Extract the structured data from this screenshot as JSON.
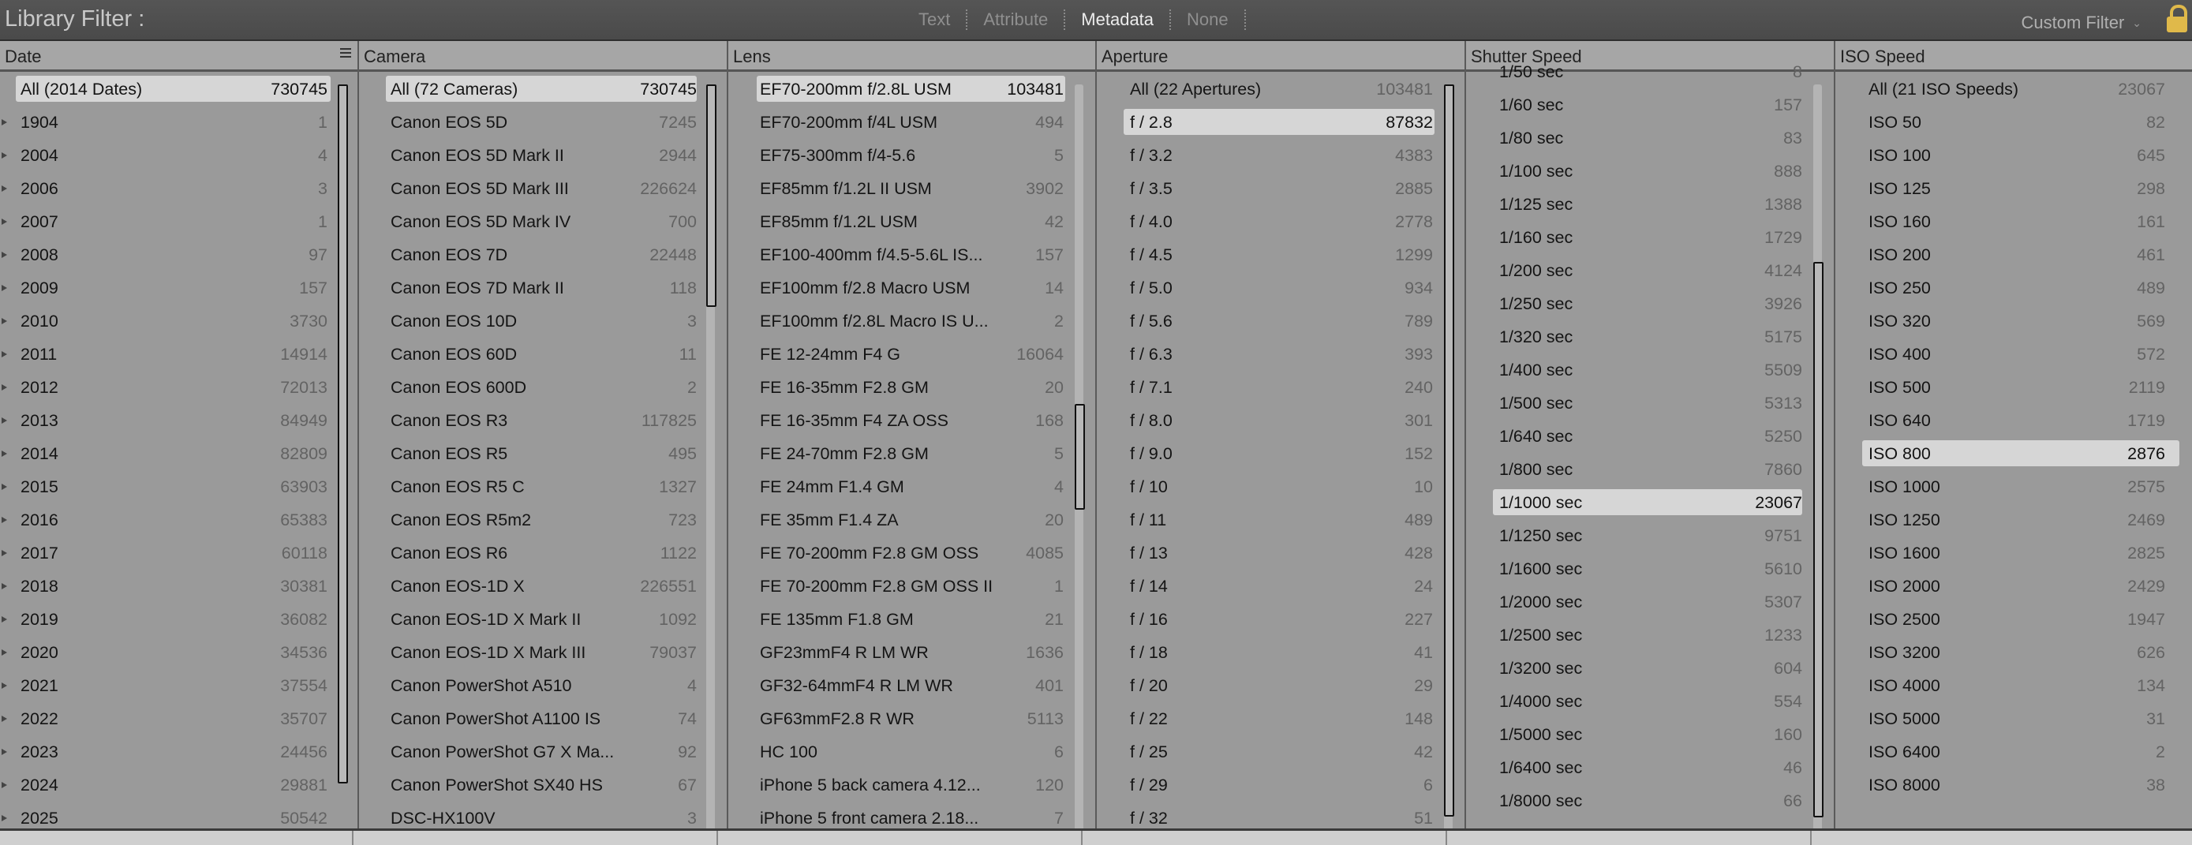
{
  "topbar": {
    "title": "Library Filter :",
    "tabs": [
      "Text",
      "Attribute",
      "Metadata",
      "None"
    ],
    "active_tab": "Metadata",
    "preset": "Custom Filter",
    "lock_color": "#e0b94a"
  },
  "columns": [
    {
      "header": "Date",
      "rows": [
        {
          "label": "All (2014 Dates)",
          "count": "730745",
          "selected": true
        },
        {
          "label": "1904",
          "count": "1",
          "expandable": true
        },
        {
          "label": "2004",
          "count": "4",
          "expandable": true
        },
        {
          "label": "2006",
          "count": "3",
          "expandable": true
        },
        {
          "label": "2007",
          "count": "1",
          "expandable": true
        },
        {
          "label": "2008",
          "count": "97",
          "expandable": true
        },
        {
          "label": "2009",
          "count": "157",
          "expandable": true
        },
        {
          "label": "2010",
          "count": "3730",
          "expandable": true
        },
        {
          "label": "2011",
          "count": "14914",
          "expandable": true
        },
        {
          "label": "2012",
          "count": "72013",
          "expandable": true
        },
        {
          "label": "2013",
          "count": "84949",
          "expandable": true
        },
        {
          "label": "2014",
          "count": "82809",
          "expandable": true
        },
        {
          "label": "2015",
          "count": "63903",
          "expandable": true
        },
        {
          "label": "2016",
          "count": "65383",
          "expandable": true
        },
        {
          "label": "2017",
          "count": "60118",
          "expandable": true
        },
        {
          "label": "2018",
          "count": "30381",
          "expandable": true
        },
        {
          "label": "2019",
          "count": "36082",
          "expandable": true
        },
        {
          "label": "2020",
          "count": "34536",
          "expandable": true
        },
        {
          "label": "2021",
          "count": "37554",
          "expandable": true
        },
        {
          "label": "2022",
          "count": "35707",
          "expandable": true
        },
        {
          "label": "2023",
          "count": "24456",
          "expandable": true
        },
        {
          "label": "2024",
          "count": "29881",
          "expandable": true
        },
        {
          "label": "2025",
          "count": "50542",
          "expandable": true
        }
      ]
    },
    {
      "header": "Camera",
      "rows": [
        {
          "label": "All (72 Cameras)",
          "count": "730745",
          "selected": true
        },
        {
          "label": "Canon EOS 5D",
          "count": "7245"
        },
        {
          "label": "Canon EOS 5D Mark II",
          "count": "2944"
        },
        {
          "label": "Canon EOS 5D Mark III",
          "count": "226624"
        },
        {
          "label": "Canon EOS 5D Mark IV",
          "count": "700"
        },
        {
          "label": "Canon EOS 7D",
          "count": "22448"
        },
        {
          "label": "Canon EOS 7D Mark II",
          "count": "118"
        },
        {
          "label": "Canon EOS 10D",
          "count": "3"
        },
        {
          "label": "Canon EOS 60D",
          "count": "11"
        },
        {
          "label": "Canon EOS 600D",
          "count": "2"
        },
        {
          "label": "Canon EOS R3",
          "count": "117825"
        },
        {
          "label": "Canon EOS R5",
          "count": "495"
        },
        {
          "label": "Canon EOS R5 C",
          "count": "1327"
        },
        {
          "label": "Canon EOS R5m2",
          "count": "723"
        },
        {
          "label": "Canon EOS R6",
          "count": "1122"
        },
        {
          "label": "Canon EOS-1D X",
          "count": "226551"
        },
        {
          "label": "Canon EOS-1D X Mark II",
          "count": "1092"
        },
        {
          "label": "Canon EOS-1D X Mark III",
          "count": "79037"
        },
        {
          "label": "Canon PowerShot A510",
          "count": "4"
        },
        {
          "label": "Canon PowerShot A1100 IS",
          "count": "74"
        },
        {
          "label": "Canon PowerShot G7 X Ma...",
          "count": "92"
        },
        {
          "label": "Canon PowerShot SX40 HS",
          "count": "67"
        },
        {
          "label": "DSC-HX100V",
          "count": "3"
        }
      ]
    },
    {
      "header": "Lens",
      "rows": [
        {
          "label": "EF70-200mm f/2.8L USM",
          "count": "103481",
          "selected": true
        },
        {
          "label": "EF70-200mm f/4L USM",
          "count": "494"
        },
        {
          "label": "EF75-300mm f/4-5.6",
          "count": "5"
        },
        {
          "label": "EF85mm f/1.2L II USM",
          "count": "3902"
        },
        {
          "label": "EF85mm f/1.2L USM",
          "count": "42"
        },
        {
          "label": "EF100-400mm f/4.5-5.6L IS...",
          "count": "157"
        },
        {
          "label": "EF100mm f/2.8 Macro USM",
          "count": "14"
        },
        {
          "label": "EF100mm f/2.8L Macro IS U...",
          "count": "2"
        },
        {
          "label": "FE 12-24mm F4 G",
          "count": "16064"
        },
        {
          "label": "FE 16-35mm F2.8 GM",
          "count": "20"
        },
        {
          "label": "FE 16-35mm F4 ZA OSS",
          "count": "168"
        },
        {
          "label": "FE 24-70mm F2.8 GM",
          "count": "5"
        },
        {
          "label": "FE 24mm F1.4 GM",
          "count": "4"
        },
        {
          "label": "FE 35mm F1.4 ZA",
          "count": "20"
        },
        {
          "label": "FE 70-200mm F2.8 GM OSS",
          "count": "4085"
        },
        {
          "label": "FE 70-200mm F2.8 GM OSS II",
          "count": "1"
        },
        {
          "label": "FE 135mm F1.8 GM",
          "count": "21"
        },
        {
          "label": "GF23mmF4 R LM WR",
          "count": "1636"
        },
        {
          "label": "GF32-64mmF4 R LM WR",
          "count": "401"
        },
        {
          "label": "GF63mmF2.8 R WR",
          "count": "5113"
        },
        {
          "label": "HC 100",
          "count": "6"
        },
        {
          "label": "iPhone 5 back camera 4.12...",
          "count": "120"
        },
        {
          "label": "iPhone 5 front camera 2.18...",
          "count": "7"
        }
      ]
    },
    {
      "header": "Aperture",
      "rows": [
        {
          "label": "All (22 Apertures)",
          "count": "103481"
        },
        {
          "label": "f / 2.8",
          "count": "87832",
          "selected": true
        },
        {
          "label": "f / 3.2",
          "count": "4383"
        },
        {
          "label": "f / 3.5",
          "count": "2885"
        },
        {
          "label": "f / 4.0",
          "count": "2778"
        },
        {
          "label": "f / 4.5",
          "count": "1299"
        },
        {
          "label": "f / 5.0",
          "count": "934"
        },
        {
          "label": "f / 5.6",
          "count": "789"
        },
        {
          "label": "f / 6.3",
          "count": "393"
        },
        {
          "label": "f / 7.1",
          "count": "240"
        },
        {
          "label": "f / 8.0",
          "count": "301"
        },
        {
          "label": "f / 9.0",
          "count": "152"
        },
        {
          "label": "f / 10",
          "count": "10"
        },
        {
          "label": "f / 11",
          "count": "489"
        },
        {
          "label": "f / 13",
          "count": "428"
        },
        {
          "label": "f / 14",
          "count": "24"
        },
        {
          "label": "f / 16",
          "count": "227"
        },
        {
          "label": "f / 18",
          "count": "41"
        },
        {
          "label": "f / 20",
          "count": "29"
        },
        {
          "label": "f / 22",
          "count": "148"
        },
        {
          "label": "f / 25",
          "count": "42"
        },
        {
          "label": "f / 29",
          "count": "6"
        },
        {
          "label": "f / 32",
          "count": "51"
        }
      ]
    },
    {
      "header": "Shutter Speed",
      "rows": [
        {
          "label": "1/50 sec",
          "count": "8"
        },
        {
          "label": "1/60 sec",
          "count": "157"
        },
        {
          "label": "1/80 sec",
          "count": "83"
        },
        {
          "label": "1/100 sec",
          "count": "888"
        },
        {
          "label": "1/125 sec",
          "count": "1388"
        },
        {
          "label": "1/160 sec",
          "count": "1729"
        },
        {
          "label": "1/200 sec",
          "count": "4124"
        },
        {
          "label": "1/250 sec",
          "count": "3926"
        },
        {
          "label": "1/320 sec",
          "count": "5175"
        },
        {
          "label": "1/400 sec",
          "count": "5509"
        },
        {
          "label": "1/500 sec",
          "count": "5313"
        },
        {
          "label": "1/640 sec",
          "count": "5250"
        },
        {
          "label": "1/800 sec",
          "count": "7860"
        },
        {
          "label": "1/1000 sec",
          "count": "23067",
          "selected": true
        },
        {
          "label": "1/1250 sec",
          "count": "9751"
        },
        {
          "label": "1/1600 sec",
          "count": "5610"
        },
        {
          "label": "1/2000 sec",
          "count": "5307"
        },
        {
          "label": "1/2500 sec",
          "count": "1233"
        },
        {
          "label": "1/3200 sec",
          "count": "604"
        },
        {
          "label": "1/4000 sec",
          "count": "554"
        },
        {
          "label": "1/5000 sec",
          "count": "160"
        },
        {
          "label": "1/6400 sec",
          "count": "46"
        },
        {
          "label": "1/8000 sec",
          "count": "66"
        }
      ]
    },
    {
      "header": "ISO Speed",
      "rows": [
        {
          "label": "All (21 ISO Speeds)",
          "count": "23067"
        },
        {
          "label": "ISO 50",
          "count": "82"
        },
        {
          "label": "ISO 100",
          "count": "645"
        },
        {
          "label": "ISO 125",
          "count": "298"
        },
        {
          "label": "ISO 160",
          "count": "161"
        },
        {
          "label": "ISO 200",
          "count": "461"
        },
        {
          "label": "ISO 250",
          "count": "489"
        },
        {
          "label": "ISO 320",
          "count": "569"
        },
        {
          "label": "ISO 400",
          "count": "572"
        },
        {
          "label": "ISO 500",
          "count": "2119"
        },
        {
          "label": "ISO 640",
          "count": "1719"
        },
        {
          "label": "ISO 800",
          "count": "2876",
          "selected": true
        },
        {
          "label": "ISO 1000",
          "count": "2575"
        },
        {
          "label": "ISO 1250",
          "count": "2469"
        },
        {
          "label": "ISO 1600",
          "count": "2825"
        },
        {
          "label": "ISO 2000",
          "count": "2429"
        },
        {
          "label": "ISO 2500",
          "count": "1947"
        },
        {
          "label": "ISO 3200",
          "count": "626"
        },
        {
          "label": "ISO 4000",
          "count": "134"
        },
        {
          "label": "ISO 5000",
          "count": "31"
        },
        {
          "label": "ISO 6400",
          "count": "2"
        },
        {
          "label": "ISO 8000",
          "count": "38"
        }
      ]
    }
  ]
}
